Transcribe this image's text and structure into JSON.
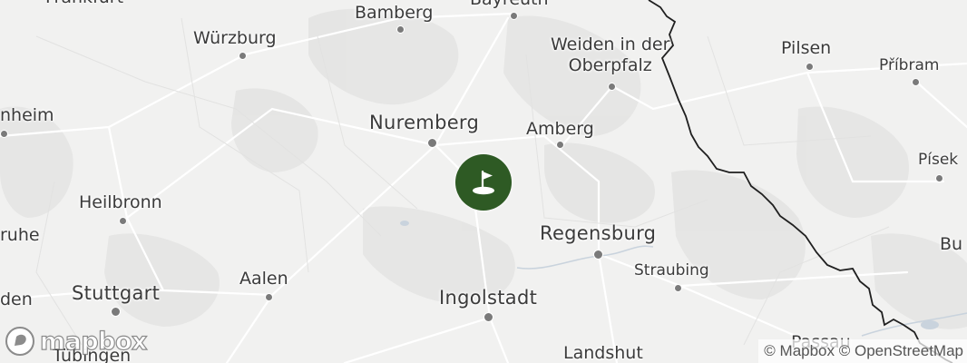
{
  "map": {
    "cities": [
      {
        "id": "frankfurt",
        "name": "Frankfurt",
        "tier": "mid"
      },
      {
        "id": "bamberg",
        "name": "Bamberg",
        "tier": "mid"
      },
      {
        "id": "bayreuth",
        "name": "Bayreuth",
        "tier": "mid"
      },
      {
        "id": "wurzburg",
        "name": "Würzburg",
        "tier": "mid"
      },
      {
        "id": "weiden",
        "name": "Weiden in der",
        "name2": "Oberpfalz",
        "tier": "mid"
      },
      {
        "id": "pilsen",
        "name": "Pilsen",
        "tier": "mid"
      },
      {
        "id": "pribram",
        "name": "Příbram",
        "tier": "small"
      },
      {
        "id": "mannheim",
        "name": "nheim",
        "tier": "mid"
      },
      {
        "id": "nuremberg",
        "name": "Nuremberg",
        "tier": "big"
      },
      {
        "id": "amberg",
        "name": "Amberg",
        "tier": "mid"
      },
      {
        "id": "pisek",
        "name": "Písek",
        "tier": "small"
      },
      {
        "id": "heilbronn",
        "name": "Heilbronn",
        "tier": "mid"
      },
      {
        "id": "karlsruhe",
        "name": "ruhe",
        "tier": "mid"
      },
      {
        "id": "regensburg",
        "name": "Regensburg",
        "tier": "big"
      },
      {
        "id": "budweis",
        "name": "Bu",
        "tier": "mid"
      },
      {
        "id": "straubing",
        "name": "Straubing",
        "tier": "small"
      },
      {
        "id": "aalen",
        "name": "Aalen",
        "tier": "mid"
      },
      {
        "id": "stuttgart",
        "name": "Stuttgart",
        "tier": "big"
      },
      {
        "id": "ingolstadt",
        "name": "Ingolstadt",
        "tier": "big"
      },
      {
        "id": "baden",
        "name": "den",
        "tier": "mid"
      },
      {
        "id": "passau",
        "name": "Passau",
        "tier": "mid"
      },
      {
        "id": "tubingen",
        "name": "Tübingen",
        "tier": "mid"
      },
      {
        "id": "landshut",
        "name": "Landshut",
        "tier": "mid"
      }
    ],
    "marker": {
      "icon": "golf-flag-icon",
      "color": "#2e5a24"
    },
    "logo": {
      "text": "mapbox",
      "icon": "mapbox-icon"
    },
    "attribution": "© Mapbox © OpenStreetMap"
  }
}
